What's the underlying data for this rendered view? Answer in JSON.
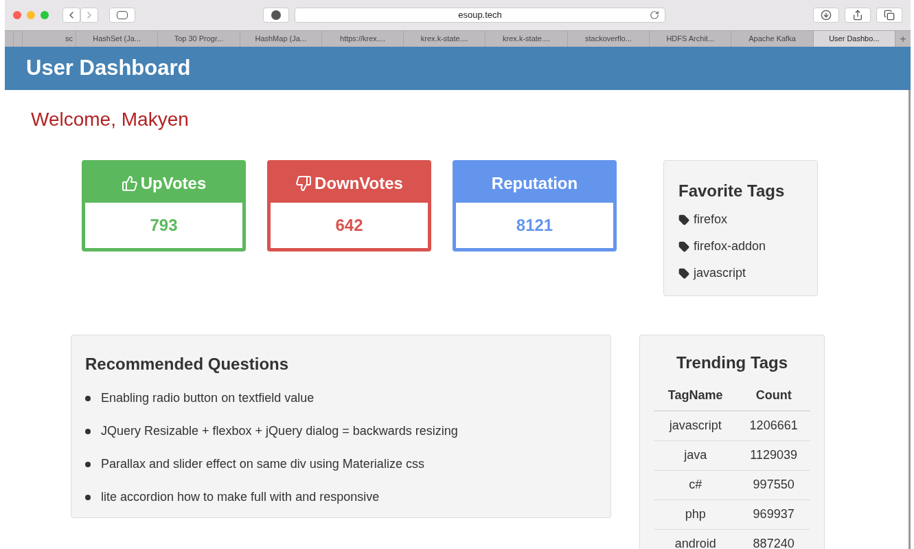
{
  "browser": {
    "address": "esoup.tech",
    "tabs": [
      {
        "selected": false
      },
      {
        "selected": false
      },
      {
        "label": "sc",
        "selected": false
      },
      {
        "label": "HashSet (Ja...",
        "selected": false
      },
      {
        "label": "Top 30 Progr...",
        "selected": false
      },
      {
        "label": "HashMap (Ja...",
        "selected": false
      },
      {
        "label": "https://krex....",
        "selected": false
      },
      {
        "label": "krex.k-state....",
        "selected": false
      },
      {
        "label": "krex.k-state....",
        "selected": false
      },
      {
        "label": "stackoverflo...",
        "selected": false
      },
      {
        "label": "HDFS Archit...",
        "selected": false
      },
      {
        "label": "Apache Kafka",
        "selected": false
      },
      {
        "label": "User Dashbo...",
        "selected": true
      }
    ],
    "new_tab": "+"
  },
  "header": {
    "title": "User Dashboard"
  },
  "welcome": "Welcome, Makyen",
  "stats": [
    {
      "kind": "up",
      "label": "UpVotes",
      "value": "793",
      "color": "#5cb85c"
    },
    {
      "kind": "down",
      "label": "DownVotes",
      "value": "642",
      "color": "#d9534f"
    },
    {
      "kind": "plain",
      "label": "Reputation",
      "value": "8121",
      "color": "#6495ed"
    }
  ],
  "favorite_tags": {
    "title": "Favorite Tags",
    "items": [
      "firefox",
      "firefox-addon",
      "javascript"
    ]
  },
  "recommended": {
    "title": "Recommended Questions",
    "items": [
      "Enabling radio button on textfield value",
      "JQuery Resizable + flexbox + jQuery dialog = backwards resizing",
      "Parallax and slider effect on same div using Materialize css",
      "lite accordion how to make full with and responsive"
    ]
  },
  "trending": {
    "title": "Trending Tags",
    "columns": [
      "TagName",
      "Count"
    ],
    "rows": [
      [
        "javascript",
        "1206661"
      ],
      [
        "java",
        "1129039"
      ],
      [
        "c#",
        "997550"
      ],
      [
        "php",
        "969937"
      ],
      [
        "android",
        "887240"
      ]
    ]
  }
}
